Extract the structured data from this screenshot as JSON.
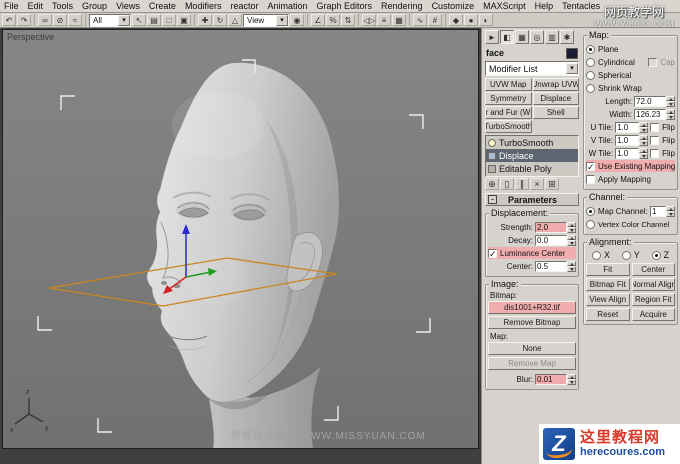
{
  "icons": {
    "chevron_down": "▾",
    "collapse": "-"
  },
  "menu": {
    "items": [
      "File",
      "Edit",
      "Tools",
      "Group",
      "Views",
      "Create",
      "Modifiers",
      "reactor",
      "Animation",
      "Graph Editors",
      "Rendering",
      "Customize",
      "MAXScript",
      "Help",
      "Tentacles"
    ]
  },
  "toolbar": {
    "filter_value": "All",
    "coordsys_value": "View",
    "icons": [
      {
        "name": "undo-icon",
        "glyph": "↶"
      },
      {
        "name": "redo-icon",
        "glyph": "↷"
      },
      {
        "name": "link-icon",
        "glyph": "∞"
      },
      {
        "name": "unlink-icon",
        "glyph": "⊘"
      },
      {
        "name": "bind-spacewarp-icon",
        "glyph": "≈"
      },
      {
        "name": "select-object-icon",
        "glyph": "↖"
      },
      {
        "name": "select-by-name-icon",
        "glyph": "▤"
      },
      {
        "name": "region-select-icon",
        "glyph": "□"
      },
      {
        "name": "crossing-select-icon",
        "glyph": "▣"
      },
      {
        "name": "select-move-icon",
        "glyph": "✚"
      },
      {
        "name": "select-rotate-icon",
        "glyph": "↻"
      },
      {
        "name": "select-scale-icon",
        "glyph": "△"
      },
      {
        "name": "use-pivot-center-icon",
        "glyph": "◉"
      },
      {
        "name": "snap-toggle-icon",
        "glyph": "∠"
      },
      {
        "name": "snap-percent-icon",
        "glyph": "%"
      },
      {
        "name": "snap-spinner-icon",
        "glyph": "⇅"
      },
      {
        "name": "mirror-icon",
        "glyph": "◁▷"
      },
      {
        "name": "align-icon",
        "glyph": "≡"
      },
      {
        "name": "layer-manager-icon",
        "glyph": "▦"
      },
      {
        "name": "curve-editor-icon",
        "glyph": "∿"
      },
      {
        "name": "schematic-view-icon",
        "glyph": "#"
      },
      {
        "name": "material-editor-icon",
        "glyph": "◆"
      },
      {
        "name": "render-scene-icon",
        "glyph": "●"
      },
      {
        "name": "quick-render-icon",
        "glyph": "◐"
      }
    ]
  },
  "viewport": {
    "label": "Perspective",
    "watermark": "思缘设计论坛 WWW.MISSYUAN.COM"
  },
  "watermarks": {
    "top_line1": "网页教学网",
    "top_line2": "WWW.WEB3X.COM",
    "logo_cn": "这里教程网",
    "logo_en": "herecoures.com",
    "logo_letter": "Z"
  },
  "panel": {
    "tabs": [
      {
        "name": "tab-create",
        "glyph": "►"
      },
      {
        "name": "tab-modify",
        "glyph": "◧"
      },
      {
        "name": "tab-hierarchy",
        "glyph": "▦"
      },
      {
        "name": "tab-motion",
        "glyph": "◎"
      },
      {
        "name": "tab-display",
        "glyph": "▥"
      },
      {
        "name": "tab-utilities",
        "glyph": "✱"
      }
    ],
    "object_name": "face",
    "modifier_list_label": "Modifier List",
    "modifier_buttons": [
      "UVW Map",
      "Unwrap UVW",
      "Symmetry",
      "Displace",
      "er and Fur (WS",
      "Shell",
      "TurboSmooth"
    ],
    "stack_items": [
      "TurboSmooth",
      "Displace",
      "Editable Poly"
    ],
    "stack_tools": [
      {
        "name": "pin-stack-icon",
        "glyph": "⊕"
      },
      {
        "name": "show-end-result-icon",
        "glyph": "▯"
      },
      {
        "name": "make-unique-icon",
        "glyph": "∥"
      },
      {
        "name": "remove-modifier-icon",
        "glyph": "×"
      },
      {
        "name": "configure-modifier-sets-icon",
        "glyph": "⊞"
      }
    ],
    "map": {
      "title": "Map:",
      "radio_plane": "Plane",
      "radio_cyl": "Cylindrical",
      "cap": "Cap",
      "radio_sph": "Spherical",
      "radio_shrink": "Shrink Wrap",
      "length_label": "Length:",
      "length": "72.0",
      "width_label": "Width:",
      "width": "126.23",
      "u_label": "U Tile:",
      "u": "1.0",
      "v_label": "V Tile:",
      "v": "1.0",
      "w_label": "W Tile:",
      "w": "1.0",
      "flip": "Flip",
      "use_existing": "Use Existing Mapping",
      "apply_mapping": "Apply Mapping"
    },
    "channel": {
      "title": "Channel:",
      "map_channel": "Map Channel:",
      "map_channel_value": "1",
      "vertex": "Vertex Color Channel"
    },
    "alignment": {
      "title": "Alignment:",
      "x": "X",
      "y": "Y",
      "z": "Z",
      "buttons": [
        "Fit",
        "Center",
        "Bitmap Fit",
        "Normal Align",
        "View Align",
        "Region Fit",
        "Reset",
        "Acquire"
      ]
    },
    "parameters": {
      "title": "Parameters",
      "displacement_title": "Displacement:",
      "strength_label": "Strength:",
      "strength": "2.0",
      "decay_label": "Decay:",
      "decay": "0.0",
      "luminance": "Luminance Center",
      "center_label": "Center:",
      "center": "0.5",
      "image_title": "Image:",
      "bitmap_label": "Bitmap:",
      "bitmap_button": "dis1001+R32.tif",
      "remove_bitmap": "Remove Bitmap",
      "map_label": "Map:",
      "map_button": "None",
      "remove_map": "Remove Map",
      "blur_label": "Blur:",
      "blur": "0.01"
    }
  },
  "colors": {
    "accent_pink": "#f0acac",
    "gizmo_orange": "#c8861e",
    "stack_selection": "#5d6670"
  }
}
